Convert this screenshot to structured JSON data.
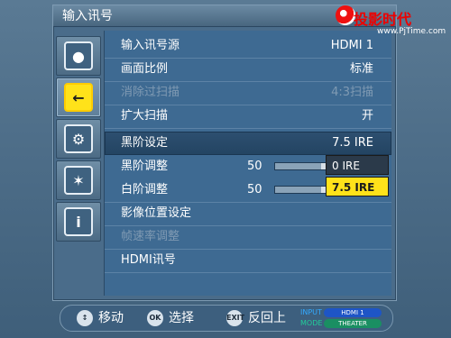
{
  "osd": {
    "title": "输入讯号",
    "menu": {
      "rows": [
        {
          "label": "输入讯号源",
          "value": "HDMI 1"
        },
        {
          "label": "画面比例",
          "value": "标准"
        },
        {
          "label": "消除过扫描",
          "value": "4:3扫描"
        },
        {
          "label": "扩大扫描",
          "value": "开"
        },
        {
          "label": "黑阶设定",
          "value": "7.5 IRE"
        },
        {
          "label": "黑阶调整",
          "number": "50",
          "level": 0.5
        },
        {
          "label": "白阶调整",
          "number": "50",
          "level": 0.5
        },
        {
          "label": "影像位置设定"
        },
        {
          "label": "帧速率调整"
        },
        {
          "label": "HDMI讯号"
        }
      ]
    },
    "dropdown": {
      "options": [
        "0 IRE",
        "7.5 IRE"
      ],
      "selected": "7.5 IRE"
    },
    "sidebar_icons": [
      "rgb-circles-icon",
      "input-arrow-icon",
      "gear-icon",
      "star-icon",
      "info-icon"
    ]
  },
  "footer": {
    "move": "移动",
    "select": "选择",
    "back": "反回上",
    "enter_label": "OK",
    "exit_label": "EXIT",
    "status": {
      "input_label": "INPUT",
      "input_value": "HDMI 1",
      "mode_label": "MODE",
      "mode_value": "THEATER"
    }
  },
  "watermark": {
    "brand": "投影时代",
    "url": "www.PjTime.com"
  },
  "colors": {
    "highlight_yellow": "#ffe21a",
    "menu_blue": "#3e6a92",
    "selected_row": "#2d4f70"
  }
}
